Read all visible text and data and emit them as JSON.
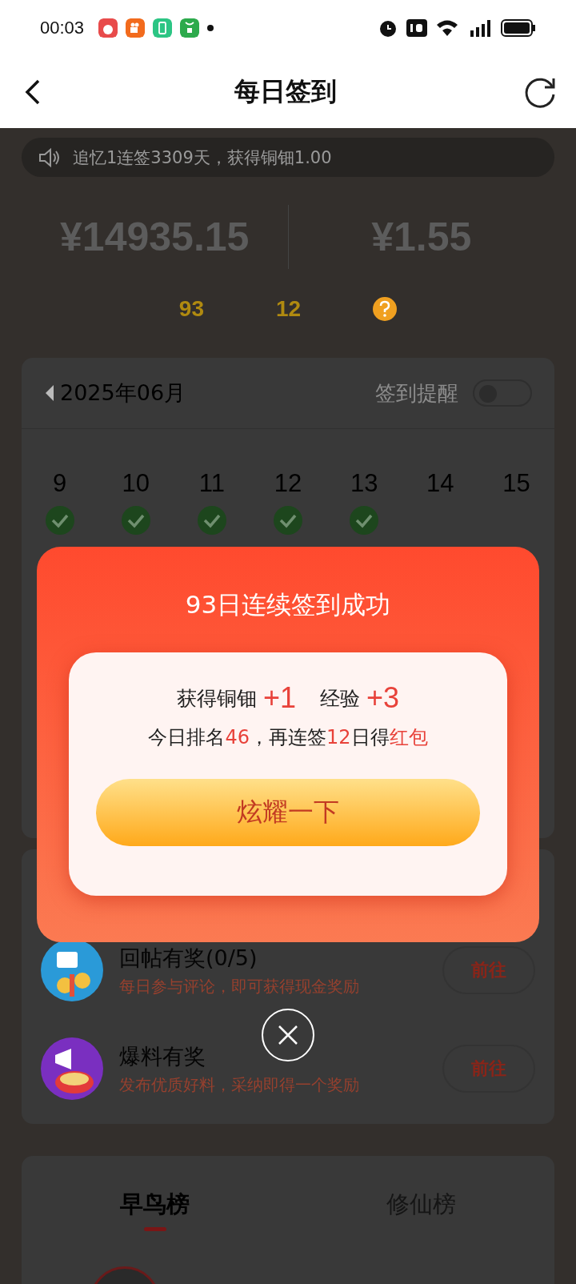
{
  "status_bar": {
    "time": "00:03"
  },
  "header": {
    "title": "每日签到"
  },
  "notice": {
    "text": "追忆1连签3309天，获得铜钿1.00"
  },
  "stats": [
    {
      "value": "¥14935.15"
    },
    {
      "value": "¥1.55"
    }
  ],
  "streak": {
    "days": "93",
    "remaining": "12"
  },
  "calendar": {
    "month": "2025年06月",
    "reminder": {
      "label": "签到提醒",
      "on": false
    },
    "days": [
      {
        "day": "9",
        "checked": true
      },
      {
        "day": "10",
        "checked": true
      },
      {
        "day": "11",
        "checked": true
      },
      {
        "day": "12",
        "checked": true
      },
      {
        "day": "13",
        "checked": true
      },
      {
        "day": "14",
        "checked": false
      },
      {
        "day": "15",
        "checked": false
      }
    ]
  },
  "tasks": [
    {
      "kind": "comment",
      "title": "回帖有奖(0/5)",
      "description": "每日参与评论，即可获得现金奖励",
      "button": "前往"
    },
    {
      "kind": "tip",
      "title": "爆料有奖",
      "description": "发布优质好料，采纳即得一个奖励",
      "button": "前往"
    }
  ],
  "leaderboard_tabs": [
    {
      "label": "早鸟榜",
      "selected": true
    },
    {
      "label": "修仙榜",
      "selected": false
    }
  ],
  "dialog": {
    "title": "93日连续签到成功",
    "rewards": [
      {
        "label": "获得铜钿",
        "amount": "+1"
      },
      {
        "label": "经验",
        "amount": "+3"
      }
    ],
    "message": [
      {
        "text": "今日排名",
        "highlight": false
      },
      {
        "text": "46",
        "highlight": true
      },
      {
        "text": "，再连签",
        "highlight": false
      },
      {
        "text": "12",
        "highlight": true
      },
      {
        "text": "日得",
        "highlight": false
      },
      {
        "text": "红包",
        "highlight": true
      }
    ],
    "button": "炫耀一下"
  }
}
